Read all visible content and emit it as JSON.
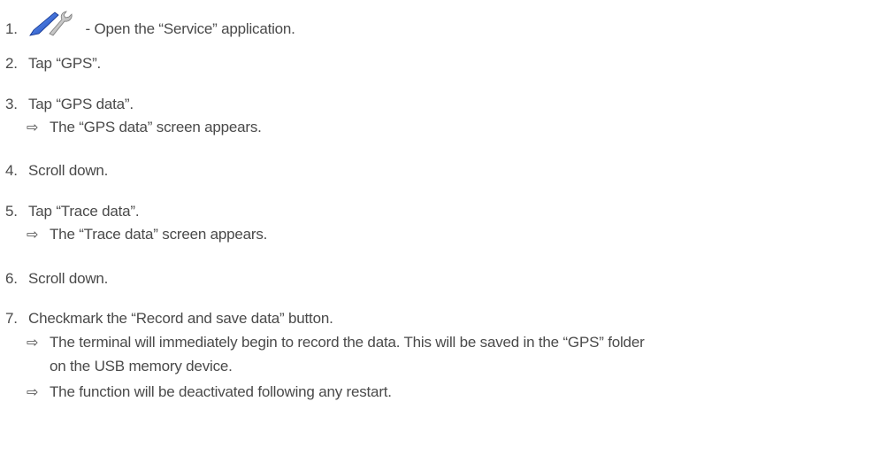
{
  "steps": [
    {
      "num": "1.",
      "text": " - Open the “Service” application.",
      "icon": "service-wrench-icon"
    },
    {
      "num": "2.",
      "text": "Tap “GPS”."
    },
    {
      "num": "3.",
      "text": "Tap “GPS data”.",
      "result": "The “GPS data” screen appears."
    },
    {
      "num": "4.",
      "text": "Scroll down."
    },
    {
      "num": "5.",
      "text": "Tap “Trace data”.",
      "result": "The “Trace data” screen appears."
    },
    {
      "num": "6.",
      "text": "Scroll down."
    },
    {
      "num": "7.",
      "text": "Checkmark the “Record and save data” button.",
      "result_a_line1": "The terminal will immediately begin to record the data. This will be saved in the “GPS” folder",
      "result_a_line2": "on the USB memory device.",
      "result_b": "The function will be deactivated following any restart."
    }
  ],
  "arrow_glyph": "⇨"
}
